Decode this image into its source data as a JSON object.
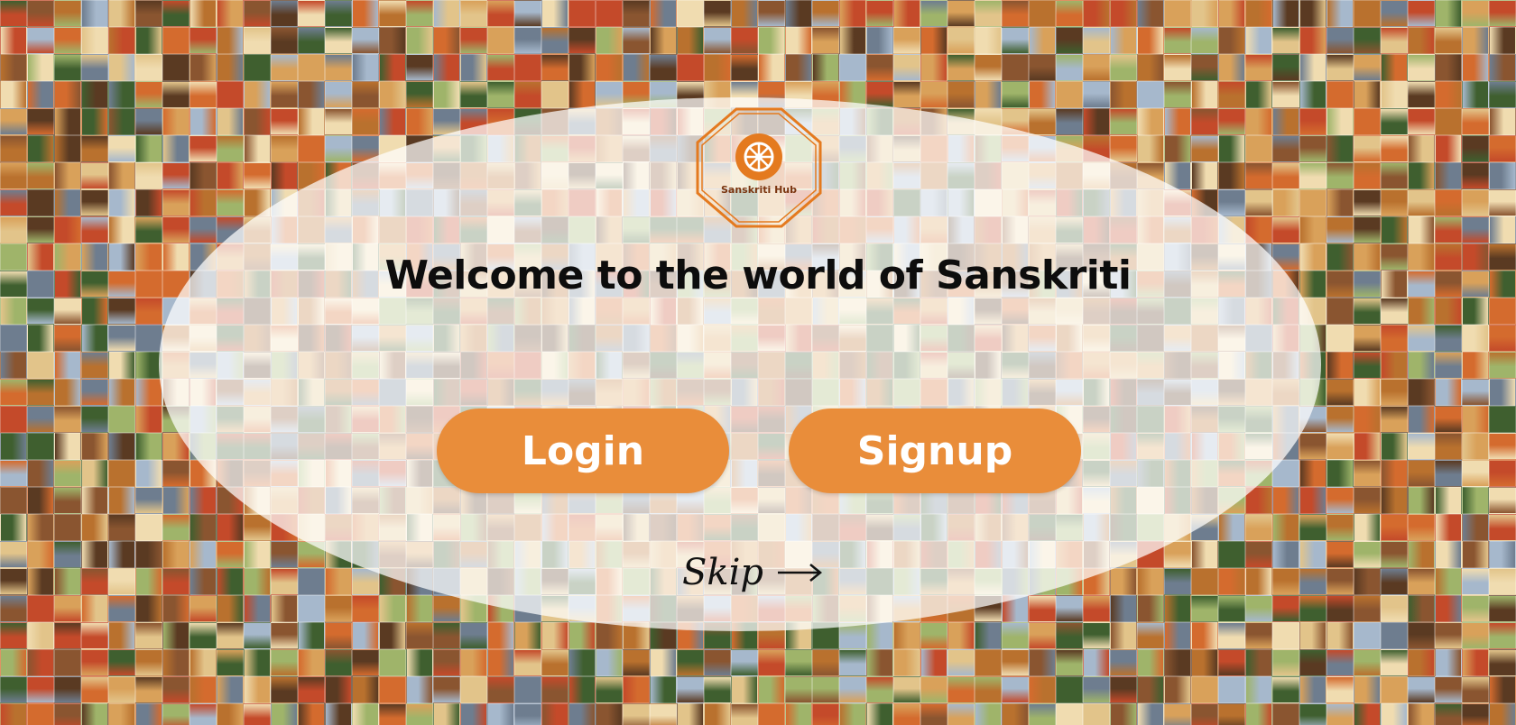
{
  "app": {
    "logo_text": "Sanskriti Hub",
    "brand_color": "#e98d3a",
    "logo_color": "#e47a1f"
  },
  "welcome": {
    "title": "Welcome to the world of Sanskriti"
  },
  "actions": {
    "login_label": "Login",
    "signup_label": "Signup",
    "skip_label": "Skip",
    "skip_icon": "arrow-right-icon"
  },
  "background": {
    "description_palette": [
      "#b9712e",
      "#d9a15a",
      "#8a5530",
      "#6e7d8f",
      "#a6b8cc",
      "#c44a2a",
      "#3f5f2f",
      "#e2c48a",
      "#5a3a22",
      "#d46b2e",
      "#9fb46a",
      "#f0dcb0"
    ]
  }
}
